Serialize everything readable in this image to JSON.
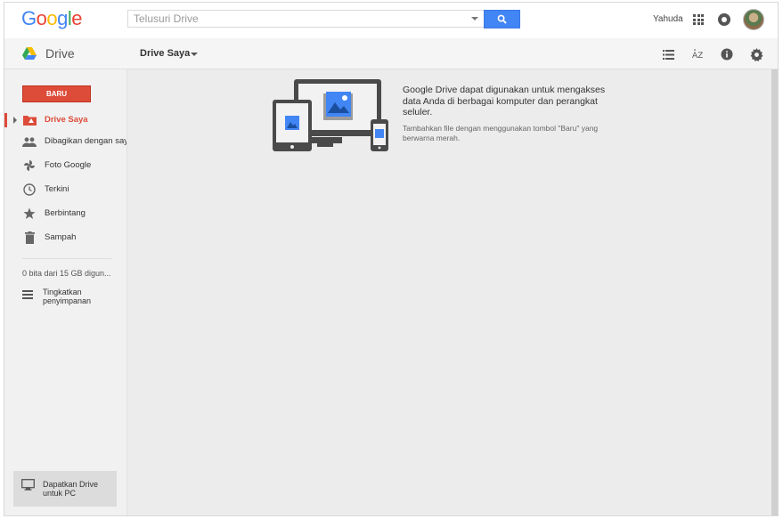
{
  "header": {
    "logo_letters": [
      "G",
      "o",
      "o",
      "g",
      "l",
      "e"
    ],
    "logo_colors": [
      "#4285f4",
      "#ea4335",
      "#fbbc05",
      "#4285f4",
      "#34a853",
      "#ea4335"
    ],
    "search": {
      "placeholder": "Telusuri Drive",
      "value": ""
    },
    "user_name": "Yahuda",
    "icons": {
      "search_button": "search-icon",
      "apps": "apps-grid-icon",
      "notifications": "notifications-icon",
      "avatar": "avatar"
    }
  },
  "subbar": {
    "product": "Drive",
    "breadcrumb": "Drive Saya",
    "tools": [
      "list-view-icon",
      "sort-az-icon",
      "info-icon",
      "settings-gear-icon"
    ]
  },
  "sidebar": {
    "new_button": "BARU",
    "items": [
      {
        "label": "Drive Saya",
        "icon": "my-drive-icon",
        "active": true
      },
      {
        "label": "Dibagikan dengan saya",
        "icon": "shared-people-icon"
      },
      {
        "label": "Foto Google",
        "icon": "pinwheel-photos-icon"
      },
      {
        "label": "Terkini",
        "icon": "clock-icon"
      },
      {
        "label": "Berbintang",
        "icon": "star-icon"
      },
      {
        "label": "Sampah",
        "icon": "trash-icon"
      }
    ],
    "storage_text": "0 bita dari 15 GB digun...",
    "upgrade_line1": "Tingkatkan",
    "upgrade_line2": "penyimpanan",
    "get_drive_line1": "Dapatkan Drive",
    "get_drive_line2": "untuk PC"
  },
  "main": {
    "empty_title": "Google Drive dapat digunakan untuk mengakses data Anda di berbagai komputer dan perangkat seluler.",
    "empty_subtitle": "Tambahkan file dengan menggunakan tombol \"Baru\" yang berwarna merah."
  },
  "colors": {
    "accent_red": "#dd4b39",
    "search_blue": "#4285f4"
  }
}
